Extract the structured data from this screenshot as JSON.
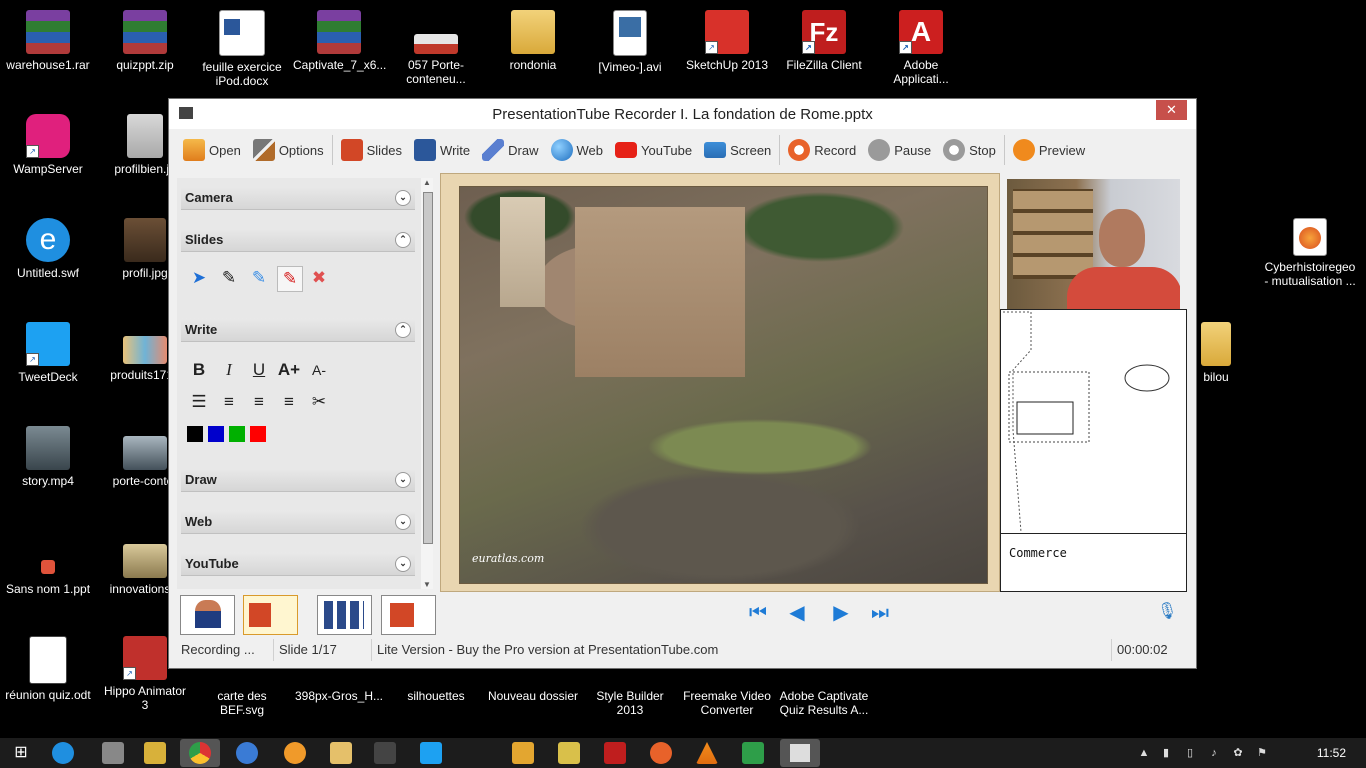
{
  "desktop": {
    "icons": [
      {
        "label": "warehouse1.rar"
      },
      {
        "label": "quizppt.zip"
      },
      {
        "label": "feuille exercice iPod.docx"
      },
      {
        "label": "Captivate_7_x6..."
      },
      {
        "label": "057 Porte-conteneu..."
      },
      {
        "label": "rondonia"
      },
      {
        "label": "[Vimeo-].avi"
      },
      {
        "label": "SketchUp 2013"
      },
      {
        "label": "FileZilla Client"
      },
      {
        "label": "Adobe Applicati..."
      },
      {
        "label": "WampServer"
      },
      {
        "label": "profilbien.jp"
      },
      {
        "label": "Untitled.swf"
      },
      {
        "label": "profil.jpg"
      },
      {
        "label": "TweetDeck"
      },
      {
        "label": "produits1713"
      },
      {
        "label": "story.mp4"
      },
      {
        "label": "porte-conter"
      },
      {
        "label": "Sans nom 1.ppt"
      },
      {
        "label": "innovations.p"
      },
      {
        "label": "réunion quiz.odt"
      },
      {
        "label": "Hippo Animator 3"
      },
      {
        "label": "carte des BEF.svg"
      },
      {
        "label": "398px-Gros_H..."
      },
      {
        "label": "silhouettes"
      },
      {
        "label": "Nouveau dossier"
      },
      {
        "label": "Style Builder 2013"
      },
      {
        "label": "Freemake Video Converter"
      },
      {
        "label": "Adobe Captivate Quiz Results A..."
      },
      {
        "label": "Cyberhistoiregeo - mutualisation ..."
      },
      {
        "label": "bilou"
      }
    ]
  },
  "window": {
    "title": "PresentationTube Recorder I. La fondation de Rome.pptx",
    "close": "✕"
  },
  "toolbar": {
    "open": "Open",
    "options": "Options",
    "slides": "Slides",
    "write": "Write",
    "draw": "Draw",
    "web": "Web",
    "youtube": "YouTube",
    "screen": "Screen",
    "record": "Record",
    "pause": "Pause",
    "stop": "Stop",
    "preview": "Preview"
  },
  "panel": {
    "camera": "Camera",
    "slides": "Slides",
    "write": "Write",
    "draw": "Draw",
    "web": "Web",
    "youtube": "YouTube",
    "text_tools": {
      "bold": "B",
      "italic": "I",
      "underline": "U",
      "grow": "A+",
      "shrink": "A-"
    },
    "colors": [
      "#000000",
      "#0000cc",
      "#00b000",
      "#ff0000"
    ]
  },
  "slide": {
    "credit": "euratlas.com",
    "caption": "Commerce"
  },
  "status": {
    "mode": "Recording ...",
    "slide": "Slide 1/17",
    "edition": "Lite Version - Buy the Pro version at PresentationTube.com",
    "time": "00:00:02"
  },
  "taskbar": {
    "clock": "11:52"
  }
}
